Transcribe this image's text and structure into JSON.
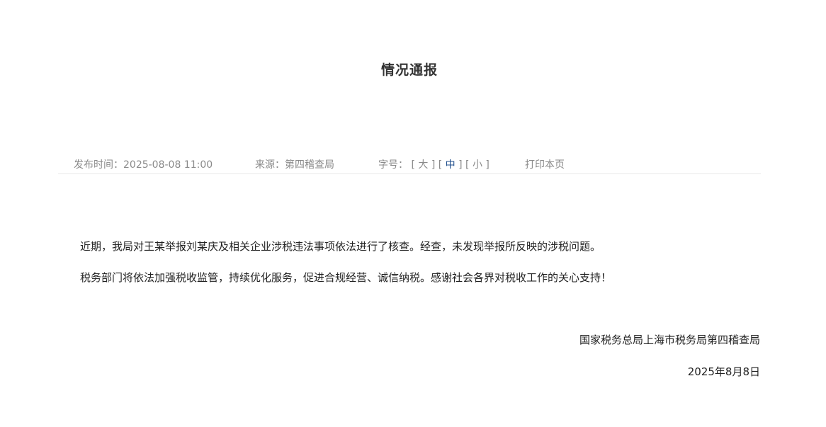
{
  "article": {
    "title": "情况通报",
    "meta": {
      "publish_label": "发布时间：",
      "publish_time": "2025-08-08 11:00",
      "source_label": "来源：",
      "source": "第四稽查局",
      "fontsize_label": "字号：",
      "fontsize_large": "大",
      "fontsize_medium": "中",
      "fontsize_small": "小",
      "print_label": "打印本页"
    },
    "paragraphs": [
      "近期，我局对王某举报刘某庆及相关企业涉税违法事项依法进行了核查。经查，未发现举报所反映的涉税问题。",
      "税务部门将依法加强税收监管，持续优化服务，促进合规经营、诚信纳税。感谢社会各界对税收工作的关心支持！"
    ],
    "signature": {
      "organization": "国家税务总局上海市税务局第四稽查局",
      "date": "2025年8月8日"
    }
  },
  "colors": {
    "active_fontsize": "#1f4e8c",
    "meta_text": "#8a8a8a"
  }
}
